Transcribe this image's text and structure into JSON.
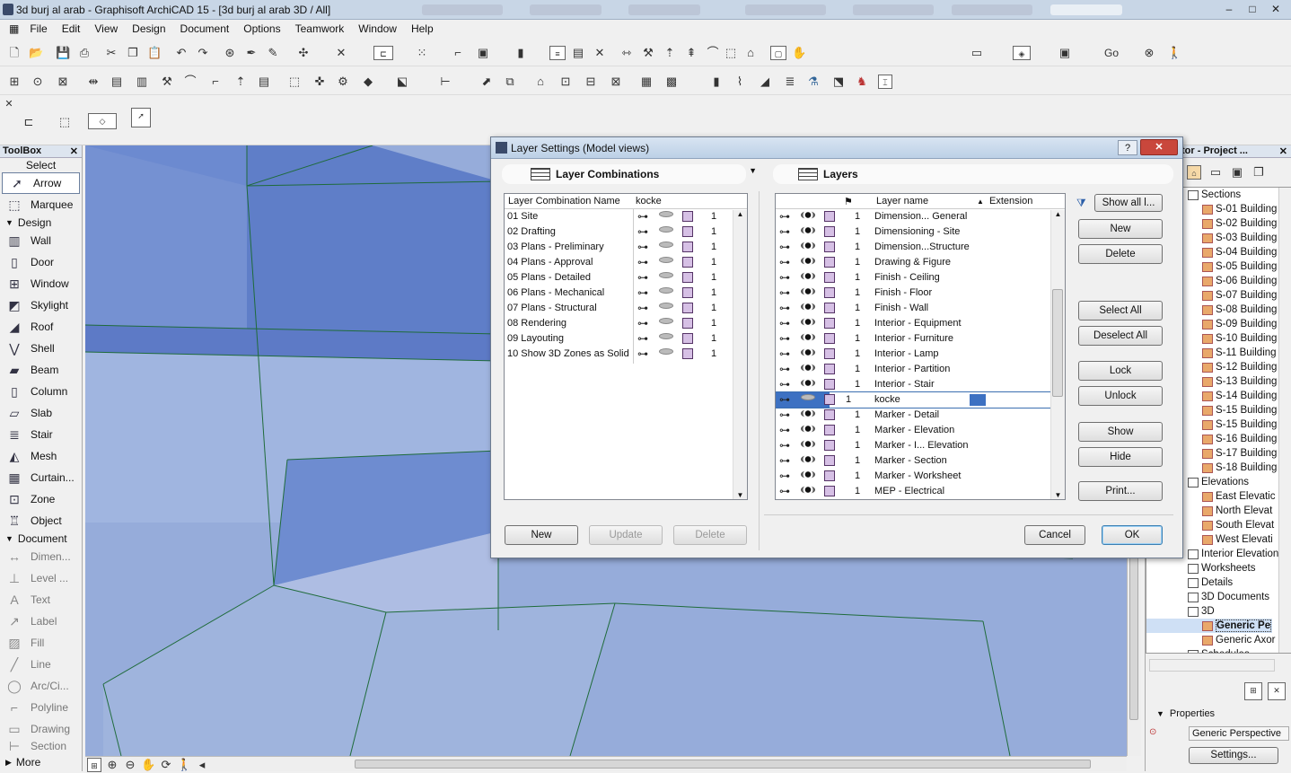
{
  "window": {
    "title": "3d burj al arab - Graphisoft ArchiCAD 15 - [3d burj al arab 3D / All]",
    "controls": [
      "–",
      "□",
      "✕"
    ]
  },
  "menu": [
    "File",
    "Edit",
    "View",
    "Design",
    "Document",
    "Options",
    "Teamwork",
    "Window",
    "Help"
  ],
  "toolbar": {
    "go_label": "Go"
  },
  "toolbox": {
    "title": "ToolBox",
    "select_label": "Select",
    "arrow": "Arrow",
    "marquee": "Marquee",
    "design_section": "Design",
    "design_tools": [
      "Wall",
      "Door",
      "Window",
      "Skylight",
      "Roof",
      "Shell",
      "Beam",
      "Column",
      "Slab",
      "Stair",
      "Mesh",
      "Curtain...",
      "Zone",
      "Object"
    ],
    "document_section": "Document",
    "document_tools": [
      "Dimen...",
      "Level ...",
      "Text",
      "Label",
      "Fill",
      "Line",
      "Arc/Ci...",
      "Polyline",
      "Drawing",
      "Section"
    ],
    "more": "More"
  },
  "navigator": {
    "title": "tor - Project ...",
    "items": [
      {
        "label": "Sections",
        "type": "folder"
      },
      {
        "label": "S-01 Building",
        "type": "house"
      },
      {
        "label": "S-02 Building",
        "type": "house"
      },
      {
        "label": "S-03 Building",
        "type": "house"
      },
      {
        "label": "S-04 Building",
        "type": "house"
      },
      {
        "label": "S-05 Building",
        "type": "house"
      },
      {
        "label": "S-06 Building",
        "type": "house"
      },
      {
        "label": "S-07 Building",
        "type": "house"
      },
      {
        "label": "S-08 Building",
        "type": "house"
      },
      {
        "label": "S-09 Building",
        "type": "house"
      },
      {
        "label": "S-10 Building",
        "type": "house"
      },
      {
        "label": "S-11 Building",
        "type": "house"
      },
      {
        "label": "S-12 Building",
        "type": "house"
      },
      {
        "label": "S-13 Building",
        "type": "house"
      },
      {
        "label": "S-14 Building",
        "type": "house"
      },
      {
        "label": "S-15 Building",
        "type": "house"
      },
      {
        "label": "S-15 Building",
        "type": "house"
      },
      {
        "label": "S-16 Building",
        "type": "house"
      },
      {
        "label": "S-17 Building",
        "type": "house"
      },
      {
        "label": "S-18 Building",
        "type": "house"
      },
      {
        "label": "Elevations",
        "type": "folder"
      },
      {
        "label": "East Elevatic",
        "type": "house"
      },
      {
        "label": "North Elevat",
        "type": "house"
      },
      {
        "label": "South Elevat",
        "type": "house"
      },
      {
        "label": "West Elevati",
        "type": "house"
      },
      {
        "label": "Interior Elevation",
        "type": "folder"
      },
      {
        "label": "Worksheets",
        "type": "folder"
      },
      {
        "label": "Details",
        "type": "folder"
      },
      {
        "label": "3D Documents",
        "type": "folder"
      },
      {
        "label": "3D",
        "type": "folder"
      },
      {
        "label": "Generic Pe",
        "type": "house"
      },
      {
        "label": "Generic Axor",
        "type": "house"
      },
      {
        "label": "Schedules",
        "type": "folder"
      }
    ],
    "properties_label": "Properties",
    "properties_value": "Generic Perspective",
    "settings_button": "Settings..."
  },
  "dialog": {
    "title": "Layer Settings (Model views)",
    "help_glyph": "?",
    "close_glyph": "✕",
    "combos_header": "Layer Combinations",
    "layers_header": "Layers",
    "combo_col_name": "Layer Combination Name",
    "combo_col_value": "kocke",
    "combos": [
      {
        "name": "01 Site",
        "num": "1"
      },
      {
        "name": "02 Drafting",
        "num": "1"
      },
      {
        "name": "03 Plans - Preliminary",
        "num": "1"
      },
      {
        "name": "04 Plans - Approval",
        "num": "1"
      },
      {
        "name": "05 Plans - Detailed",
        "num": "1"
      },
      {
        "name": "06 Plans - Mechanical",
        "num": "1"
      },
      {
        "name": "07 Plans - Structural",
        "num": "1"
      },
      {
        "name": "08 Rendering",
        "num": "1"
      },
      {
        "name": "09 Layouting",
        "num": "1"
      },
      {
        "name": "10 Show 3D Zones as Solid",
        "num": "1"
      }
    ],
    "layer_col_name": "Layer name",
    "layer_col_ext": "Extension",
    "layers": [
      {
        "num": "1",
        "name": "Dimension... General"
      },
      {
        "num": "1",
        "name": "Dimensioning - Site"
      },
      {
        "num": "1",
        "name": "Dimension...Structure"
      },
      {
        "num": "1",
        "name": "Drawing & Figure"
      },
      {
        "num": "1",
        "name": "Finish - Ceiling"
      },
      {
        "num": "1",
        "name": "Finish - Floor"
      },
      {
        "num": "1",
        "name": "Finish - Wall"
      },
      {
        "num": "1",
        "name": "Interior - Equipment"
      },
      {
        "num": "1",
        "name": "Interior - Furniture"
      },
      {
        "num": "1",
        "name": "Interior - Lamp"
      },
      {
        "num": "1",
        "name": "Interior - Partition"
      },
      {
        "num": "1",
        "name": "Interior - Stair"
      },
      {
        "num": "1",
        "name": "kocke",
        "selected": true
      },
      {
        "num": "1",
        "name": "Marker - Detail"
      },
      {
        "num": "1",
        "name": "Marker - Elevation"
      },
      {
        "num": "1",
        "name": "Marker - I... Elevation"
      },
      {
        "num": "1",
        "name": "Marker - Section"
      },
      {
        "num": "1",
        "name": "Marker - Worksheet"
      },
      {
        "num": "1",
        "name": "MEP - Electrical"
      }
    ],
    "show_all": "Show all l...",
    "buttons": {
      "new": "New",
      "delete": "Delete",
      "select_all": "Select All",
      "deselect_all": "Deselect All",
      "lock": "Lock",
      "unlock": "Unlock",
      "show": "Show",
      "hide": "Hide",
      "print": "Print..."
    },
    "combo_buttons": {
      "new": "New",
      "update": "Update",
      "delete": "Delete"
    },
    "cancel": "Cancel",
    "ok": "OK"
  }
}
